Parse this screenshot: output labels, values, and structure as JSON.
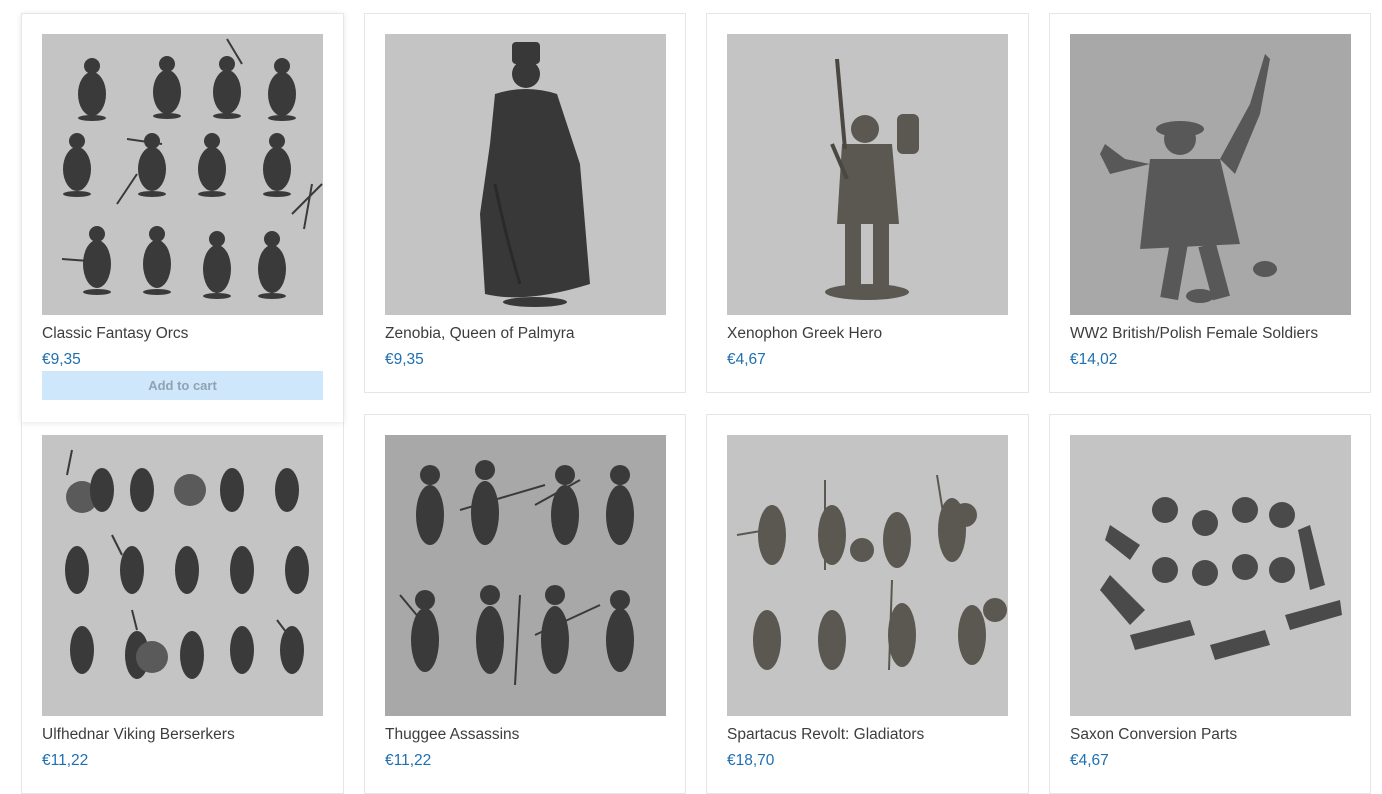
{
  "colors": {
    "price": "#1f6fb0",
    "title": "#3d3d3d",
    "image_bg": "#c2c2c2",
    "add_to_cart_bg": "#cfe7fb"
  },
  "products": [
    {
      "title": "Classic Fantasy Orcs",
      "price": "€9,35",
      "image": "orc-miniatures-group-image",
      "add_to_cart": "Add to cart"
    },
    {
      "title": "Zenobia, Queen of Palmyra",
      "price": "€9,35",
      "image": "queen-miniature-image"
    },
    {
      "title": "Xenophon Greek Hero",
      "price": "€4,67",
      "image": "greek-hero-miniature-image"
    },
    {
      "title": "WW2 British/Polish Female Soldiers",
      "price": "€14,02",
      "image": "ww2-soldier-miniature-image"
    },
    {
      "title": "Ulfhednar Viking Berserkers",
      "price": "€11,22",
      "image": "viking-miniatures-group-image"
    },
    {
      "title": "Thuggee Assassins",
      "price": "€11,22",
      "image": "assassin-miniatures-group-image"
    },
    {
      "title": "Spartacus Revolt: Gladiators",
      "price": "€18,70",
      "image": "gladiator-miniatures-group-image"
    },
    {
      "title": "Saxon Conversion Parts",
      "price": "€4,67",
      "image": "conversion-parts-image"
    }
  ]
}
